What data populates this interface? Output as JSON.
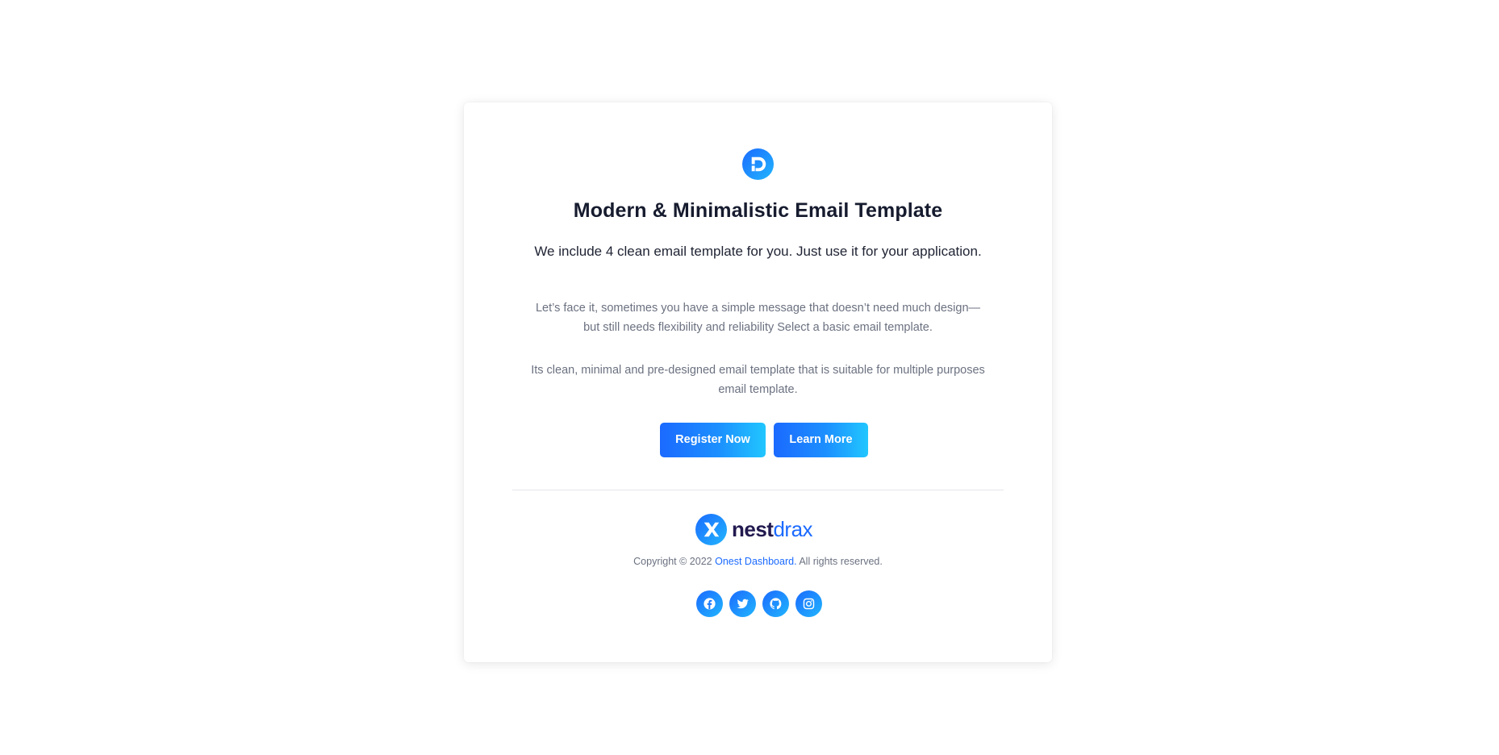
{
  "header": {
    "logo_icon": "d-logo-icon",
    "title": "Modern & Minimalistic Email Template",
    "subtitle": "We include 4 clean email template for you. Just use it for your application."
  },
  "body": {
    "paragraph_1": "Let’s face it, sometimes you have a simple message that doesn’t need much design—but still needs flexibility and reliability Select a basic email template.",
    "paragraph_2": "Its clean, minimal and pre-designed email template that is suitable for multiple purposes email template."
  },
  "actions": {
    "register_label": "Register Now",
    "learn_label": "Learn More"
  },
  "footer": {
    "brand_icon": "nestdrax-logo-icon",
    "brand_primary": "nest",
    "brand_secondary": "drax",
    "copyright_prefix": "Copyright © 2022",
    "copyright_link": "Onest Dashboard.",
    "copyright_suffix": "All rights reserved.",
    "socials": [
      "facebook-icon",
      "twitter-icon",
      "github-icon",
      "instagram-icon"
    ]
  },
  "colors": {
    "accent": "#1b6aff",
    "accent_light": "#21c6ff",
    "brand_dark": "#221a4f",
    "text_dark": "#161b2e",
    "text_muted": "#6b7180"
  }
}
